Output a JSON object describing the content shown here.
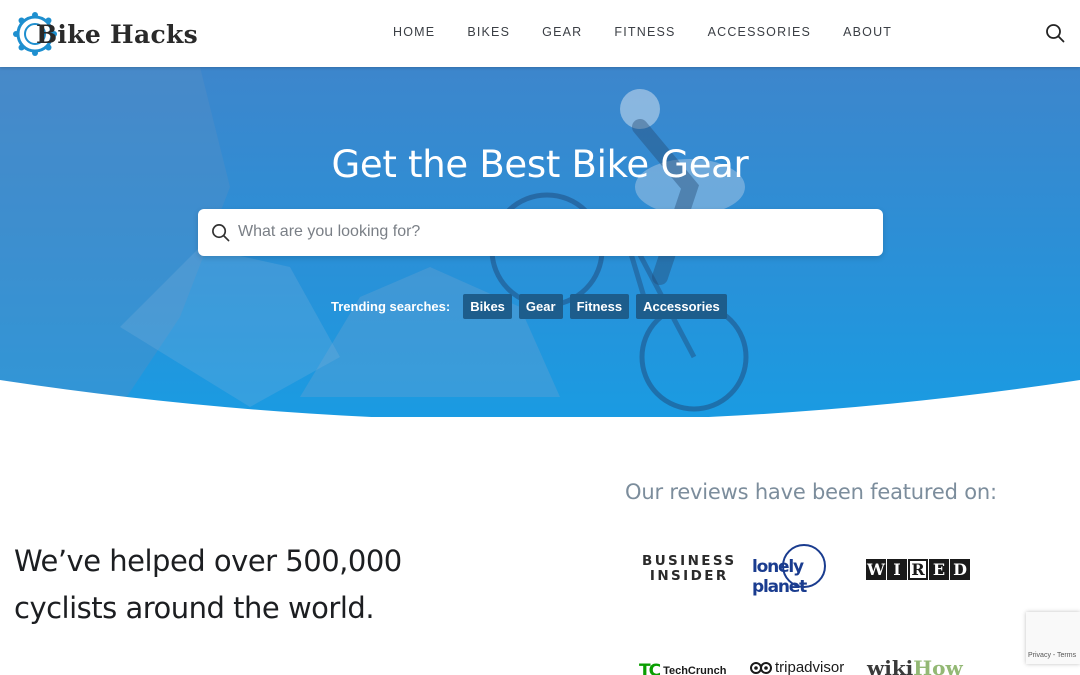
{
  "brand": {
    "name": "Bike Hacks"
  },
  "nav": {
    "items": [
      "HOME",
      "BIKES",
      "GEAR",
      "FITNESS",
      "ACCESSORIES",
      "ABOUT"
    ]
  },
  "hero": {
    "title": "Get the Best Bike Gear",
    "search_placeholder": "What are you looking for?",
    "trending_label": "Trending searches:",
    "trending_tags": [
      "Bikes",
      "Gear",
      "Fitness",
      "Accessories"
    ]
  },
  "stats": {
    "line1": "We’ve helped over 500,000",
    "line2": "cyclists around the world."
  },
  "featured": {
    "title": "Our reviews have been featured on:",
    "logos": {
      "business_insider_1": "BUSINESS",
      "business_insider_2": "INSIDER",
      "lonely_planet": "lonely planet",
      "wired": [
        "W",
        "I",
        "R",
        "E",
        "D"
      ],
      "techcrunch_mark": "TC",
      "techcrunch": "TechCrunch",
      "tripadvisor": "tripadvisor",
      "wikihow_1": "wiki",
      "wikihow_2": "How"
    }
  },
  "recaptcha": {
    "text": "Privacy - Terms"
  },
  "colors": {
    "hero_blue": "#2c8fd6",
    "tag_bg": "#1d5d8c",
    "logo_accent": "#1e8fcf",
    "featured_gray": "#7c8d9c"
  },
  "icons": {
    "logo": "bike-chain-icon",
    "search": "search-icon"
  }
}
